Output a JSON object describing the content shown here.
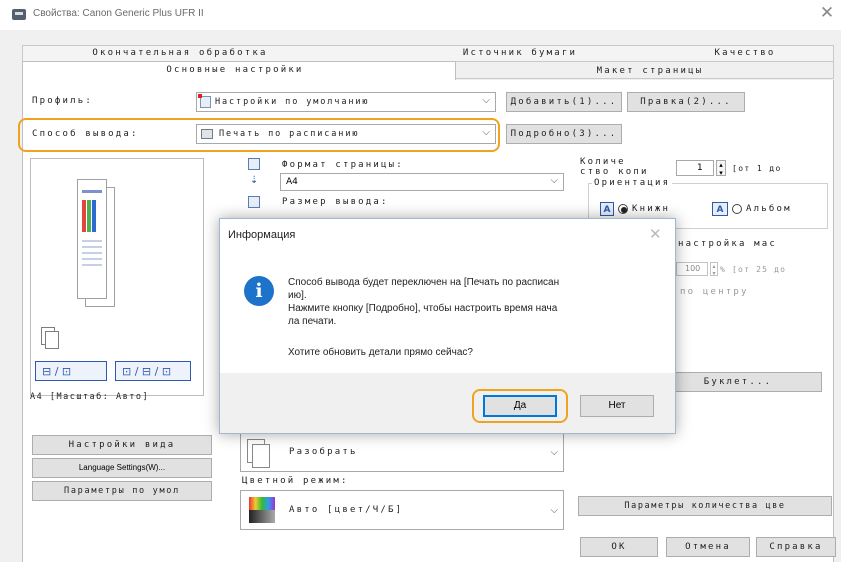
{
  "window": {
    "title": "Свойства: Canon Generic Plus UFR II"
  },
  "tabs": {
    "row1": [
      "Окончательная обработка",
      "Источник бумаги",
      "Качество"
    ],
    "row2": [
      "Основные настройки",
      "Макет страницы"
    ]
  },
  "profile": {
    "label": "Профиль:",
    "value": "Настройки по умолчанию",
    "add_label": "Добавить(1)...",
    "edit_label": "Правка(2)..."
  },
  "output": {
    "label": "Способ вывода:",
    "value": "Печать по расписанию",
    "details_label": "Подробно(3)..."
  },
  "page": {
    "format_label": "Формат страницы:",
    "format_value": "A4",
    "size_label": "Размер вывода:"
  },
  "copies": {
    "label_line1": "Количе",
    "label_line2": "ство копи",
    "value": "1",
    "suffix": "[от 1 до"
  },
  "orientation": {
    "label": "Ориентация",
    "portrait": "Книжн",
    "landscape": "Альбом"
  },
  "right_partial": {
    "scale_label": "настройка мас",
    "scale_value": "100",
    "scale_range": "% [от 25 до",
    "center": "по центру",
    "booklet_label": "Буклет..."
  },
  "preview": {
    "caption": "A4 [Масштаб: Авто]"
  },
  "buttons": {
    "view_settings": "Настройки вида",
    "language_settings": "Language Settings(W)...",
    "restore_defaults": "Параметры по умол"
  },
  "collate": {
    "value": "Разобрать"
  },
  "color_mode": {
    "label": "Цветной режим:",
    "value": "Авто [цвет/Ч/Б]"
  },
  "color_params_label": "Параметры количества цве",
  "footer": {
    "ok": "OK",
    "cancel": "Отмена",
    "help": "Справка"
  },
  "dialog": {
    "title": "Информация",
    "message": "Способ вывода будет переключен на [Печать по расписан\nию].\nНажмите кнопку [Подробно], чтобы настроить время нача\nла печати.",
    "question": "Хотите обновить детали прямо сейчас?",
    "yes": "Да",
    "no": "Нет"
  },
  "colors": {
    "highlight": "#f0a31f",
    "info": "#1d73c9",
    "dialog_border": "#9fb7cf"
  }
}
